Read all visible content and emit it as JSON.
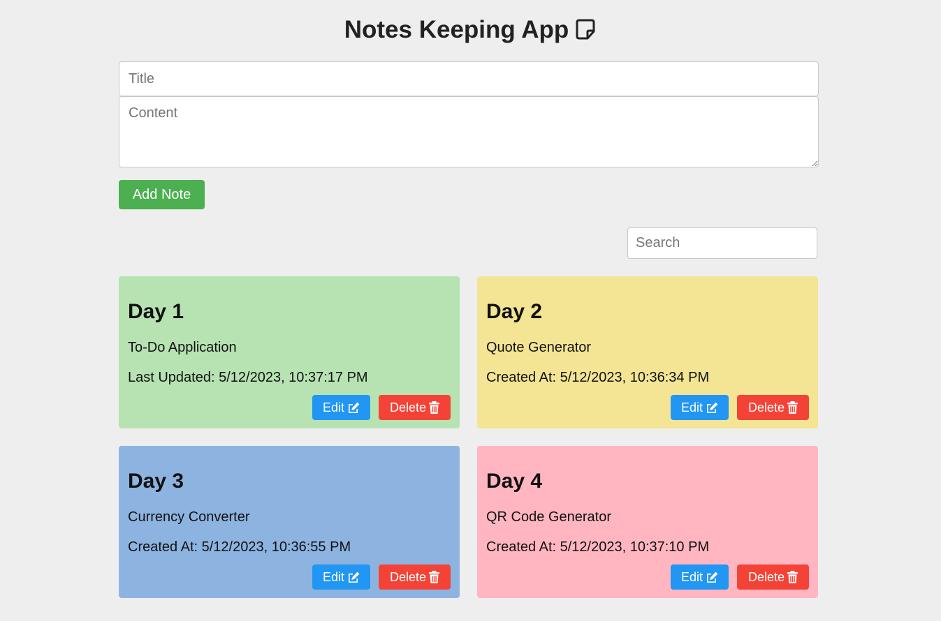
{
  "header": {
    "title": "Notes Keeping App",
    "icon": "sticky-note-icon"
  },
  "form": {
    "title_placeholder": "Title",
    "content_placeholder": "Content",
    "add_button": "Add Note",
    "add_button_color": "#4caf50"
  },
  "search": {
    "placeholder": "Search"
  },
  "notes": [
    {
      "title": "Day 1",
      "content": "To-Do Application",
      "timestamp": "Last Updated: 5/12/2023, 10:37:17 PM",
      "color": "#b7e3b2",
      "edit_label": "Edit",
      "delete_label": "Delete"
    },
    {
      "title": "Day 2",
      "content": "Quote Generator",
      "timestamp": "Created At: 5/12/2023, 10:36:34 PM",
      "color": "#f3e594",
      "edit_label": "Edit",
      "delete_label": "Delete"
    },
    {
      "title": "Day 3",
      "content": "Currency Converter",
      "timestamp": "Created At: 5/12/2023, 10:36:55 PM",
      "color": "#8db4e1",
      "edit_label": "Edit",
      "delete_label": "Delete"
    },
    {
      "title": "Day 4",
      "content": "QR Code Generator",
      "timestamp": "Created At: 5/12/2023, 10:37:10 PM",
      "color": "#ffb6c1",
      "edit_label": "Edit",
      "delete_label": "Delete"
    }
  ],
  "colors": {
    "edit": "#2196f3",
    "delete": "#f44336",
    "background": "#eeeeee"
  }
}
